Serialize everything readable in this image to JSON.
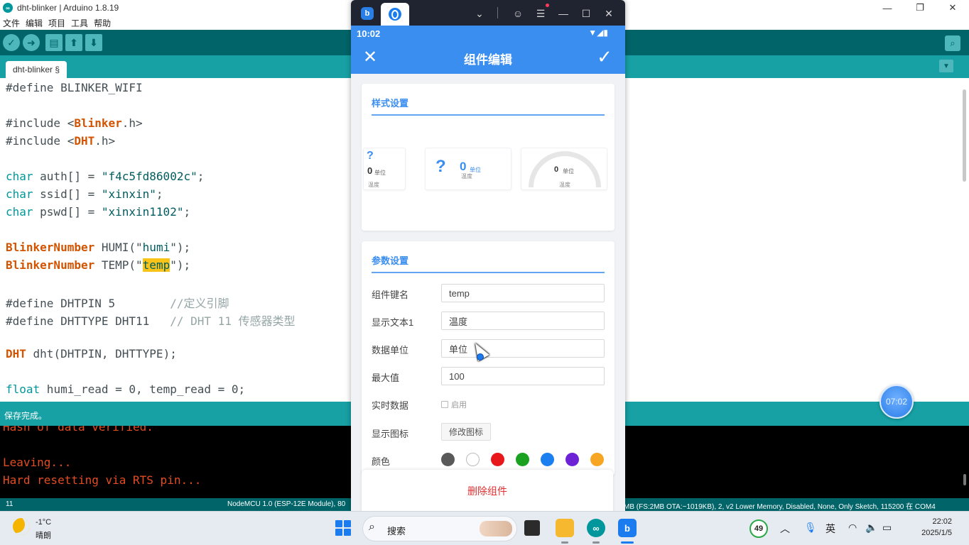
{
  "arduino": {
    "title": "dht-blinker | Arduino 1.8.19",
    "menu": [
      "文件",
      "编辑",
      "项目",
      "工具",
      "帮助"
    ],
    "tab_label": "dht-blinker §",
    "status_text": "保存完成。",
    "line_number": "11",
    "board_info_left": "NodeMCU 1.0 (ESP-12E Module), 80",
    "board_info_right": "MB (FS:2MB OTA:~1019KB), 2, v2 Lower Memory, Disabled, None, Only Sketch, 115200 在 COM4",
    "code": {
      "l1": "#define BLINKER_WIFI",
      "l3_a": "#include <",
      "l3_b": "Blinker",
      "l3_c": ".h>",
      "l4_a": "#include <",
      "l4_b": "DHT",
      "l4_c": ".h>",
      "l6_a": "char",
      "l6_b": " auth[] = ",
      "l6_c": "\"f4c5fd86002c\"",
      "l6_d": ";",
      "l7_a": "char",
      "l7_b": " ssid[] = ",
      "l7_c": "\"xinxin\"",
      "l7_d": ";",
      "l8_a": "char",
      "l8_b": " pswd[] = ",
      "l8_c": "\"xinxin1102\"",
      "l8_d": ";",
      "l10_a": "BlinkerNumber",
      "l10_b": " HUMI(\"",
      "l10_c": "humi",
      "l10_d": "\");",
      "l11_a": "BlinkerNumber",
      "l11_b": " TEMP(\"",
      "l11_c": "temp",
      "l11_d": "\");",
      "l13_a": "#define DHTPIN 5        ",
      "l13_b": "//定义引脚",
      "l14_a": "#define DHTTYPE DHT11   ",
      "l14_b": "// DHT 11 传感器类型",
      "l16_a": "DHT",
      "l16_b": " dht(DHTPIN, DHTTYPE);",
      "l18_a": "float",
      "l18_b": " humi_read = 0, temp_read = 0;"
    },
    "console": {
      "l1": "Hash of data verified.",
      "l2": "Leaving...",
      "l3": "Hard resetting via RTS pin..."
    }
  },
  "timer": {
    "value": "07:02"
  },
  "phone": {
    "status_time": "10:02",
    "header_title": "组件编辑",
    "style_section": {
      "title": "样式设置",
      "option1": {
        "value": "0",
        "unit": "单位",
        "label": "温度"
      },
      "option2": {
        "value": "0",
        "unit": "单位",
        "label": "温度"
      },
      "option3": {
        "value": "0",
        "unit": "单位",
        "label": "温度"
      }
    },
    "param_section": {
      "title": "参数设置",
      "key_label": "组件键名",
      "key_value": "temp",
      "text1_label": "显示文本1",
      "text1_value": "温度",
      "unit_label": "数据单位",
      "unit_value": "单位",
      "max_label": "最大值",
      "max_value": "100",
      "realtime_label": "实时数据",
      "realtime_option": "启用",
      "icon_label": "显示图标",
      "icon_button": "修改图标",
      "color_label": "颜色"
    },
    "colors": [
      "#595959",
      "#ffffff",
      "#e8171c",
      "#1aa11f",
      "#1c7ff0",
      "#6e22d6",
      "#f6a623"
    ],
    "delete_button": "删除组件"
  },
  "taskbar": {
    "weather_temp": "-1°C",
    "weather_cond": "晴朗",
    "search_placeholder": "搜索",
    "tray_badge": "49",
    "ime": "英",
    "clock_time": "22:02",
    "clock_date": "2025/1/5"
  }
}
